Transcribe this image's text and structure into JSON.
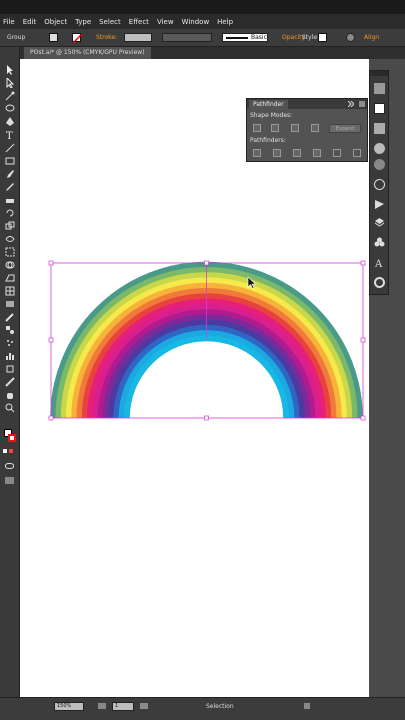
{
  "menu": [
    "File",
    "Edit",
    "Object",
    "Type",
    "Select",
    "Effect",
    "View",
    "Window",
    "Help"
  ],
  "control": {
    "selection_label": "Group",
    "stroke_label": "Stroke:",
    "brush_label": "Basic",
    "opacity_label": "Opacity",
    "style_label": "Style:",
    "align_label": "Align"
  },
  "document_tab": "POst.ai* @ 150% (CMYK/GPU Preview)",
  "pathfinder": {
    "title": "Pathfinder",
    "shape_modes_label": "Shape Modes:",
    "pathfinders_label": "Pathfinders:",
    "expand_label": "Expand"
  },
  "status": {
    "zoom": "150%",
    "page": "1",
    "tool": "Selection"
  },
  "colors": {
    "accent": "#f29a1d",
    "selection": "#d23cd2",
    "rainbow_bands": [
      "#4a9a8a",
      "#7bb86a",
      "#c9d84a",
      "#f6e94b",
      "#f7b23a",
      "#f07a3a",
      "#e8423e",
      "#e6207a",
      "#d91e8e",
      "#b01c8f",
      "#7a2a9a",
      "#4b3aa0",
      "#2f66c4",
      "#1ca8e0",
      "#18b8e4"
    ]
  },
  "icons": [
    "selection-tool-icon",
    "direct-selection-tool-icon",
    "magic-wand-icon",
    "lasso-icon",
    "pen-icon",
    "type-icon",
    "line-icon",
    "rectangle-icon",
    "paintbrush-icon",
    "pencil-icon",
    "eraser-icon",
    "rotate-icon",
    "scale-icon",
    "width-icon",
    "free-transform-icon",
    "shape-builder-icon",
    "perspective-icon",
    "mesh-icon",
    "gradient-icon",
    "eyedropper-icon",
    "blend-icon",
    "symbol-sprayer-icon",
    "graph-icon",
    "artboard-icon",
    "slice-icon",
    "hand-icon",
    "zoom-icon"
  ]
}
